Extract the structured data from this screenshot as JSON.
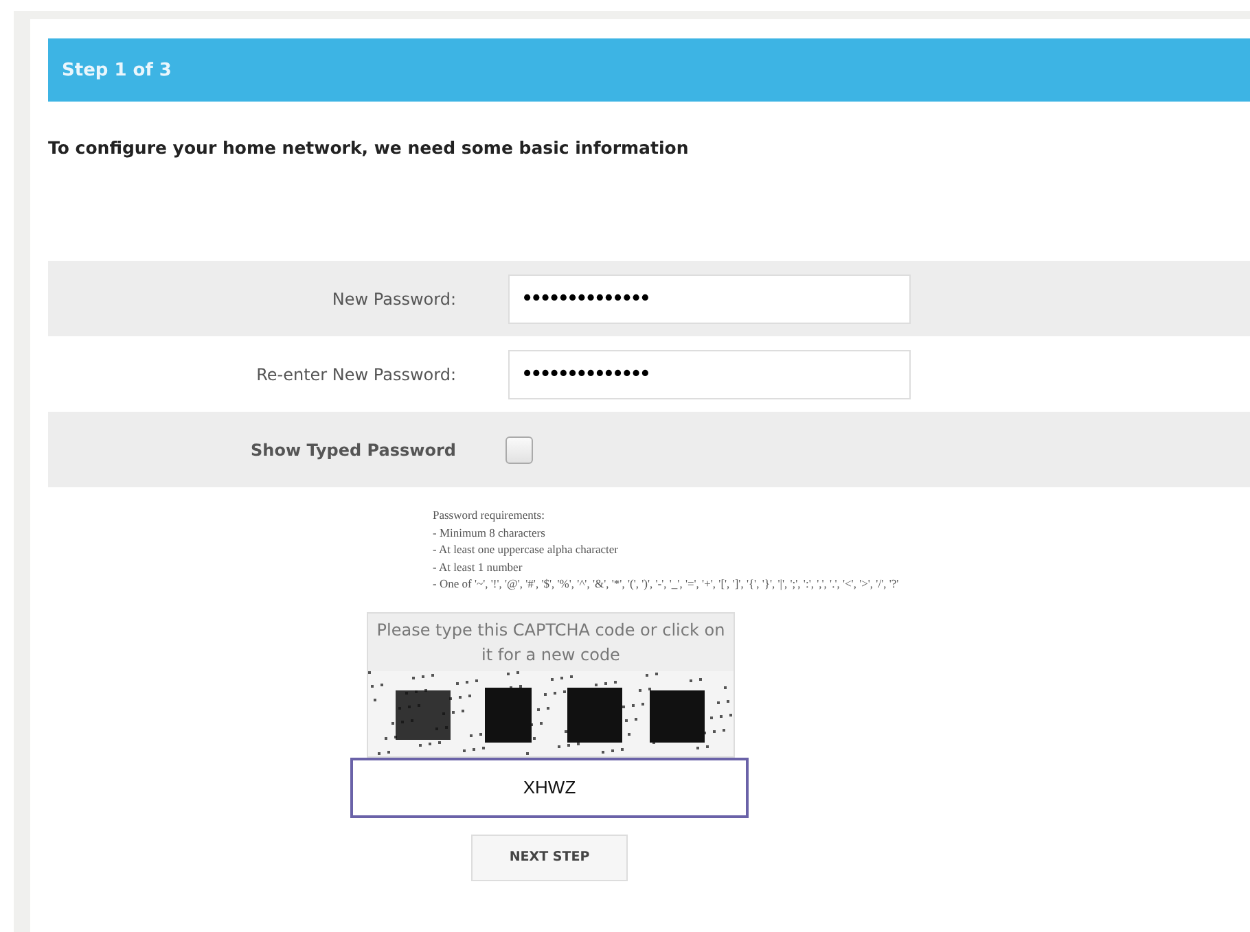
{
  "header": {
    "title": "Step 1 of 3"
  },
  "intro": "To configure your home network, we need some basic information",
  "fields": [
    {
      "kind": "password",
      "label": "New Password:",
      "value": "••••••••••••••"
    },
    {
      "kind": "password",
      "label": "Re-enter New Password:",
      "value": "••••••••••••••"
    },
    {
      "kind": "checkbox",
      "label": "Show Typed Password",
      "checked": false
    }
  ],
  "requirements": {
    "title": "Password requirements:",
    "items": [
      "- Minimum 8 characters",
      "- At least one uppercase alpha character",
      "- At least 1 number",
      "- One of '~', '!', '@', '#', '$', '%', '^', '&', '*', '(', ')', '-', '_', '=', '+', '[', ']', '{', '}', '|', ';', ':', ',', '.', '<', '>', '/', '?'"
    ]
  },
  "captcha": {
    "prompt": "Please type this CAPTCHA code or click on it for a new code",
    "value": "XHWZ"
  },
  "next_button": "NEXT STEP"
}
